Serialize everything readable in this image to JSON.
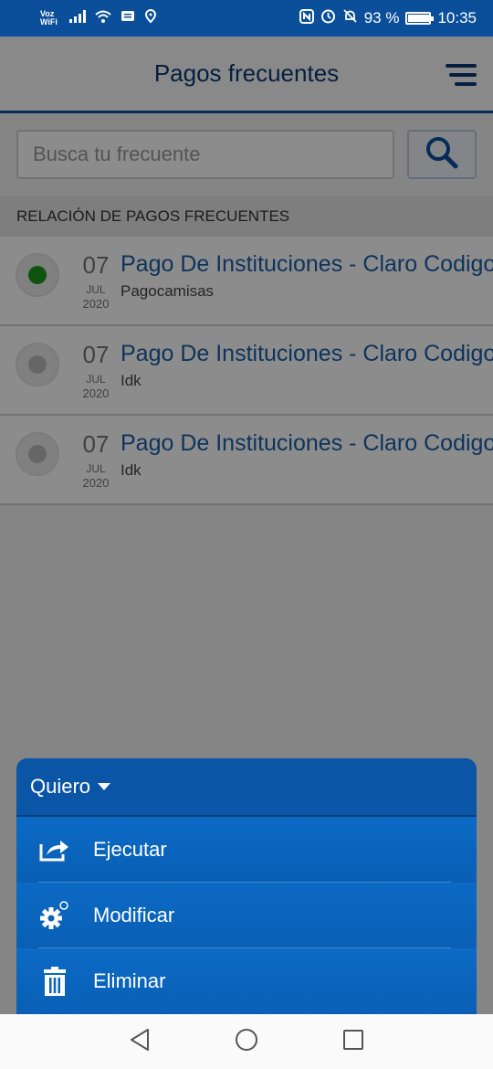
{
  "status_bar": {
    "carrier": "Voz WiFi",
    "battery_percent": "93 %",
    "battery_level": 0.93,
    "time": "10:35",
    "icons": [
      "signal-icon",
      "wifi-icon",
      "message-icon",
      "location-icon",
      "nfc-icon",
      "alarm-icon",
      "mute-icon",
      "battery-icon"
    ]
  },
  "header": {
    "title": "Pagos frecuentes",
    "menu_icon": "hamburger-menu-icon"
  },
  "search": {
    "placeholder": "Busca tu frecuente",
    "value": "",
    "button_icon": "search-icon"
  },
  "section": {
    "title": "RELACIÓN DE PAGOS FRECUENTES"
  },
  "payments": [
    {
      "day": "07",
      "month": "JUL",
      "year": "2020",
      "name": "Pago De Instituciones - Claro Codigo",
      "alias": "Pagocamisas",
      "selected": true
    },
    {
      "day": "07",
      "month": "JUL",
      "year": "2020",
      "name": "Pago De Instituciones - Claro Codigo",
      "alias": "Idk",
      "selected": false
    },
    {
      "day": "07",
      "month": "JUL",
      "year": "2020",
      "name": "Pago De Instituciones - Claro Codigo",
      "alias": "Idk",
      "selected": false
    }
  ],
  "action_sheet": {
    "title": "Quiero",
    "actions": [
      {
        "label": "Ejecutar",
        "icon": "share-icon"
      },
      {
        "label": "Modificar",
        "icon": "gear-icon"
      },
      {
        "label": "Eliminar",
        "icon": "trash-icon"
      }
    ]
  },
  "nav_bar": {
    "icons": [
      "back-icon",
      "home-icon",
      "recents-icon"
    ]
  },
  "colors": {
    "primary": "#0b4f9b",
    "link": "#1a5fa8",
    "selected": "#1a9a1a"
  }
}
